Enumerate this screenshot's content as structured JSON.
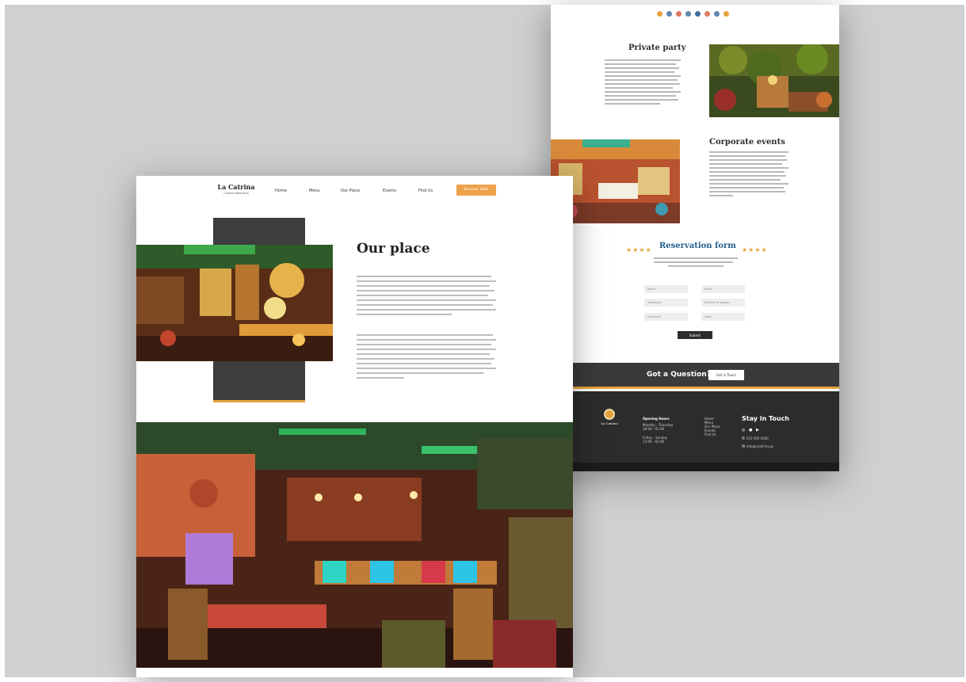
{
  "backdrop_color": "#cfd0d2",
  "accent_color": "#e5a33b",
  "decor": {
    "dot_colors": [
      "#e5a33b",
      "#5f86ad",
      "#e07a5f",
      "#5f86ad",
      "#3d6e9a",
      "#e07a5f",
      "#5f86ad",
      "#e5a33b"
    ]
  },
  "front": {
    "brand": {
      "name": "La Catrina",
      "sub": "Cantina Mexicana"
    },
    "nav": {
      "items": [
        "Home",
        "Menu",
        "Our Place",
        "Events",
        "Find Us"
      ],
      "cta": "Reserve Table"
    },
    "our_place": {
      "title": "Our place"
    }
  },
  "back": {
    "private_party": {
      "title": "Private party"
    },
    "corporate": {
      "title": "Corporate events"
    },
    "reservation": {
      "title": "Reservation form",
      "stars": "★★★★",
      "fields": [
        "Name",
        "Email",
        "Telephone",
        "Number of people",
        "Comment",
        "Date"
      ],
      "submit": "Submit"
    },
    "question": {
      "text": "Got a Question?",
      "button": "Get in Touch"
    },
    "footer": {
      "logo_label": "La Catrina",
      "hours_title": "Opening Hours",
      "hours_lines": [
        "Monday - Thursday",
        "18:00 - 01:00"
      ],
      "hours_lines2": [
        "Friday - Sunday",
        "13:00 - 02:00"
      ],
      "links": [
        "Home",
        "Menu",
        "Our Place",
        "Events",
        "Find Us"
      ],
      "stay_title": "Stay in Touch",
      "phone": "210 000 0000",
      "email": "info@lacatrina.gr"
    }
  }
}
